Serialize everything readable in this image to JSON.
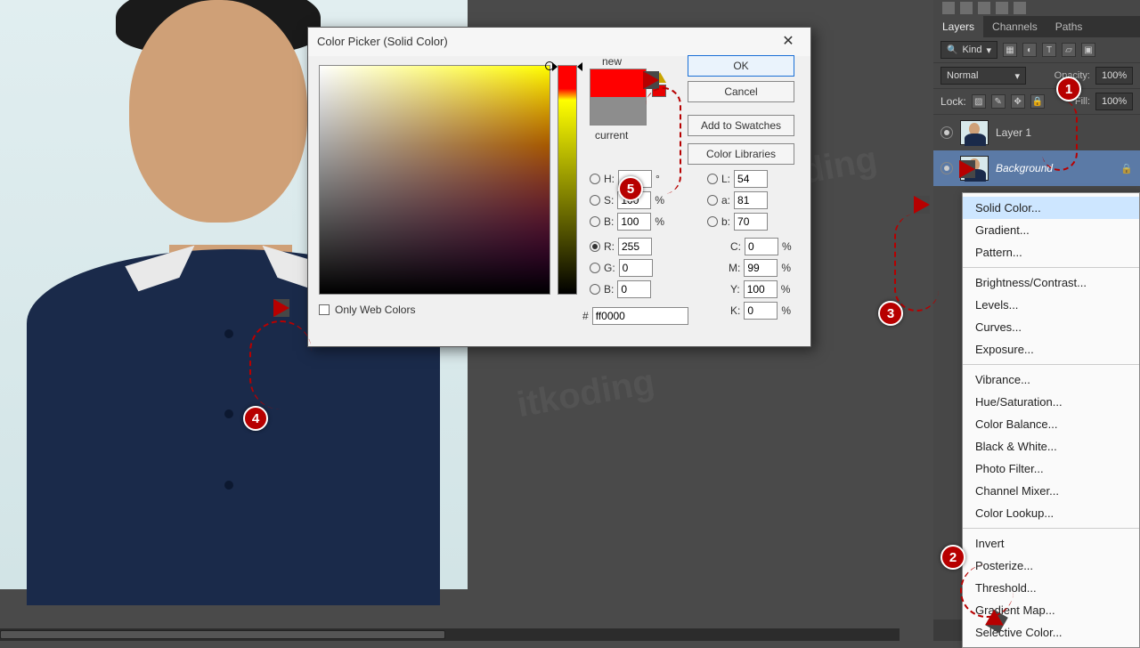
{
  "dialog": {
    "title": "Color Picker (Solid Color)",
    "new_label": "new",
    "current_label": "current",
    "buttons": {
      "ok": "OK",
      "cancel": "Cancel",
      "add_swatches": "Add to Swatches",
      "color_libraries": "Color Libraries"
    },
    "only_web": "Only Web Colors",
    "hex_prefix": "#",
    "fields": {
      "H": {
        "label": "H:",
        "value": "",
        "unit": "°"
      },
      "S": {
        "label": "S:",
        "value": "100",
        "unit": "%"
      },
      "Bv": {
        "label": "B:",
        "value": "100",
        "unit": "%"
      },
      "R": {
        "label": "R:",
        "value": "255"
      },
      "G": {
        "label": "G:",
        "value": "0"
      },
      "Bb": {
        "label": "B:",
        "value": "0"
      },
      "L": {
        "label": "L:",
        "value": "54"
      },
      "a": {
        "label": "a:",
        "value": "81"
      },
      "b": {
        "label": "b:",
        "value": "70"
      },
      "C": {
        "label": "C:",
        "value": "0",
        "unit": "%"
      },
      "M": {
        "label": "M:",
        "value": "99",
        "unit": "%"
      },
      "Y": {
        "label": "Y:",
        "value": "100",
        "unit": "%"
      },
      "K": {
        "label": "K:",
        "value": "0",
        "unit": "%"
      },
      "hex": {
        "value": "ff0000"
      }
    },
    "swatch": {
      "new": "#ff0000",
      "current": "#8d8d8d"
    }
  },
  "panel": {
    "tabs": {
      "layers": "Layers",
      "channels": "Channels",
      "paths": "Paths"
    },
    "kind_label": "Kind",
    "blend_mode": "Normal",
    "blend_dropdown_icon": "▾",
    "opacity_label": "Opacity:",
    "opacity_value": "100%",
    "fill_label": "Fill:",
    "fill_value": "100%",
    "lock_label": "Lock:",
    "layers": [
      {
        "name": "Layer 1",
        "locked": false
      },
      {
        "name": "Background",
        "locked": true
      }
    ]
  },
  "fill_menu": {
    "groups": [
      [
        "Solid Color...",
        "Gradient...",
        "Pattern..."
      ],
      [
        "Brightness/Contrast...",
        "Levels...",
        "Curves...",
        "Exposure..."
      ],
      [
        "Vibrance...",
        "Hue/Saturation...",
        "Color Balance...",
        "Black & White...",
        "Photo Filter...",
        "Channel Mixer...",
        "Color Lookup..."
      ],
      [
        "Invert",
        "Posterize...",
        "Threshold...",
        "Gradient Map...",
        "Selective Color..."
      ]
    ]
  },
  "annotations": {
    "b1": "1",
    "b2": "2",
    "b3": "3",
    "b4": "4",
    "b5": "5"
  }
}
